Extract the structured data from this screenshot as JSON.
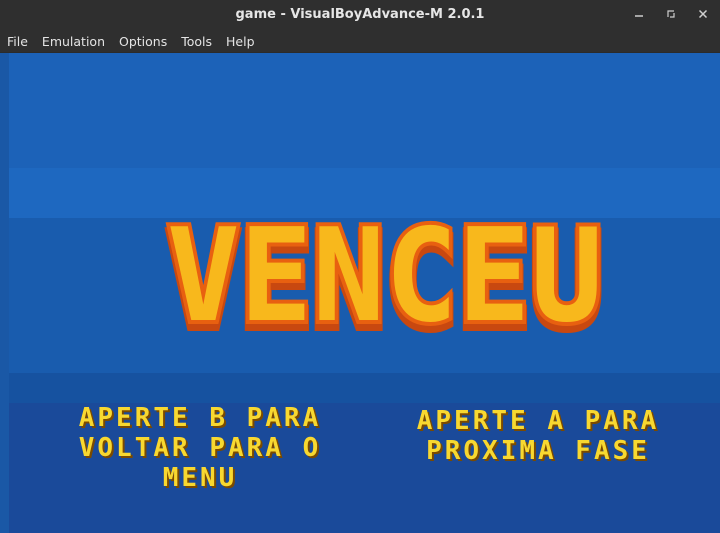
{
  "window": {
    "title": "game - VisualBoyAdvance-M 2.0.1"
  },
  "controls": {
    "minimize_icon": "minimize-icon",
    "maximize_icon": "maximize-icon",
    "close_icon": "close-icon"
  },
  "menu": {
    "items": [
      {
        "label": "File"
      },
      {
        "label": "Emulation"
      },
      {
        "label": "Options"
      },
      {
        "label": "Tools"
      },
      {
        "label": "Help"
      }
    ]
  },
  "game": {
    "title": "VENCEU",
    "option_b": {
      "line1": "APERTE B PARA",
      "line2": "VOLTAR PARA O",
      "line3": "MENU"
    },
    "option_a": {
      "line1": "APERTE A PARA",
      "line2": "PROXIMA FASE"
    },
    "colors": {
      "background": "#1b5aa8",
      "logo_fill": "#f8b81c",
      "logo_outline": "#e86010",
      "text": "#f8d830"
    }
  }
}
